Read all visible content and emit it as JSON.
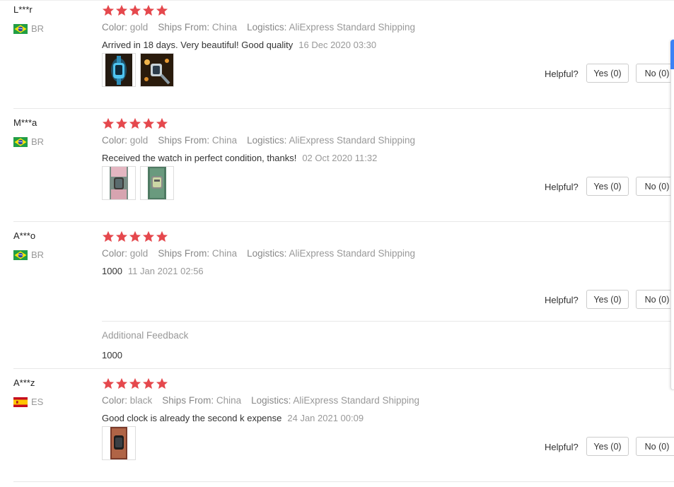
{
  "helpful_label": "Helpful?",
  "attr_labels": {
    "color": "Color:",
    "ships": "Ships From:",
    "logistics": "Logistics:"
  },
  "additional_feedback": {
    "title": "Additional Feedback",
    "text": "1000"
  },
  "colors": {
    "star": "#e5484d",
    "accent": "#3b82f6",
    "muted": "#999999"
  },
  "reviews": [
    {
      "name": "L***r",
      "country": "BR",
      "flag": "brazil-flag-icon",
      "stars": 5,
      "color": "gold",
      "ships_from": "China",
      "logistics": "AliExpress Standard Shipping",
      "text": "Arrived in 18 days. Very beautiful! Good quality",
      "date": "16 Dec 2020 03:30",
      "photos": [
        "review-photo-glowing-watch",
        "review-photo-watch-with-lights"
      ],
      "yes": "Yes (0)",
      "no": "No (0)"
    },
    {
      "name": "M***a",
      "country": "BR",
      "flag": "brazil-flag-icon",
      "stars": 5,
      "color": "gold",
      "ships_from": "China",
      "logistics": "AliExpress Standard Shipping",
      "text": "Received the watch in perfect condition, thanks!",
      "date": "02 Oct 2020 11:32",
      "photos": [
        "review-photo-watch-on-wrist",
        "review-photo-watch-screen"
      ],
      "yes": "Yes (0)",
      "no": "No (0)"
    },
    {
      "name": "A***o",
      "country": "BR",
      "flag": "brazil-flag-icon",
      "stars": 5,
      "color": "gold",
      "ships_from": "China",
      "logistics": "AliExpress Standard Shipping",
      "text": "1000",
      "date": "11 Jan 2021 02:56",
      "photos": [],
      "yes": "Yes (0)",
      "no": "No (0)"
    },
    {
      "name": "A***z",
      "country": "ES",
      "flag": "spain-flag-icon",
      "stars": 5,
      "color": "black",
      "ships_from": "China",
      "logistics": "AliExpress Standard Shipping",
      "text": "Good clock is already the second k expense",
      "date": "24 Jan 2021 00:09",
      "photos": [
        "review-photo-black-watch"
      ],
      "yes": "Yes (0)",
      "no": "No (0)"
    }
  ]
}
